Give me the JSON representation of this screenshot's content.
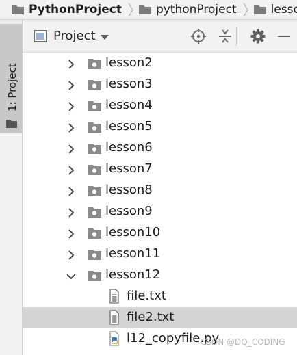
{
  "breadcrumb": {
    "items": [
      {
        "label": "PythonProject",
        "bold": true
      },
      {
        "label": "pythonProject",
        "bold": false
      },
      {
        "label": "lesson",
        "bold": false
      }
    ]
  },
  "tool_window_strip": {
    "tab_label": "1: Project"
  },
  "project_panel": {
    "view_selector_label": "Project",
    "header_icons": [
      "locate-target-icon",
      "collapse-all-icon",
      "gear-icon",
      "minimize-icon"
    ]
  },
  "tree": {
    "items": [
      {
        "label": "lesson2",
        "type": "folder",
        "expanded": false
      },
      {
        "label": "lesson3",
        "type": "folder",
        "expanded": false
      },
      {
        "label": "lesson4",
        "type": "folder",
        "expanded": false
      },
      {
        "label": "lesson5",
        "type": "folder",
        "expanded": false
      },
      {
        "label": "lesson6",
        "type": "folder",
        "expanded": false
      },
      {
        "label": "lesson7",
        "type": "folder",
        "expanded": false
      },
      {
        "label": "lesson8",
        "type": "folder",
        "expanded": false
      },
      {
        "label": "lesson9",
        "type": "folder",
        "expanded": false
      },
      {
        "label": "lesson10",
        "type": "folder",
        "expanded": false
      },
      {
        "label": "lesson11",
        "type": "folder",
        "expanded": false
      },
      {
        "label": "lesson12",
        "type": "folder",
        "expanded": true
      },
      {
        "label": "file.txt",
        "type": "text-file",
        "selected": false
      },
      {
        "label": "file2.txt",
        "type": "text-file",
        "selected": true
      },
      {
        "label": "l12_copyfile.py",
        "type": "python-file",
        "selected": false
      }
    ]
  },
  "watermark": "CSDN @DQ_CODING",
  "colors": {
    "chrome_bg": "#f2f2f2",
    "panel_bg": "#ffffff",
    "selection_bg": "#d4d4d4",
    "tab_active_bg": "#c8c8c8",
    "folder_icon": "#8a8a8a",
    "python_blue": "#3f7cbf",
    "python_yellow": "#f2c43d"
  }
}
